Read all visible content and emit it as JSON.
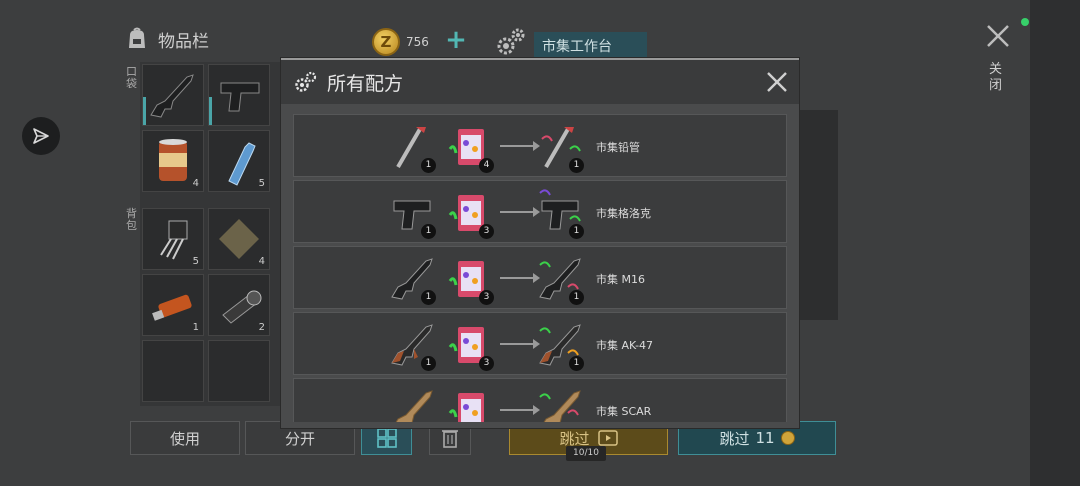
{
  "inventory": {
    "title": "物品栏",
    "pocket_label": "口袋",
    "backpack_label": "背包",
    "slots": [
      {
        "name": "rifle",
        "count": ""
      },
      {
        "name": "pistol",
        "count": ""
      },
      {
        "name": "canned-food",
        "count": "4"
      },
      {
        "name": "water-bottle",
        "count": "5"
      },
      {
        "name": "transistor",
        "count": "5"
      },
      {
        "name": "cloth",
        "count": "4"
      },
      {
        "name": "usb-drive",
        "count": "1"
      },
      {
        "name": "flashlight",
        "count": "2"
      }
    ]
  },
  "currency": {
    "coins": "756",
    "coin_glyph": "Z"
  },
  "workbench": {
    "label": "市集工作台"
  },
  "close": {
    "label": "关闭"
  },
  "modal": {
    "title": "所有配方",
    "recipes": [
      {
        "input_count": "1",
        "material_count": "4",
        "output_count": "1",
        "name": "市集铅管"
      },
      {
        "input_count": "1",
        "material_count": "3",
        "output_count": "1",
        "name": "市集格洛克"
      },
      {
        "input_count": "1",
        "material_count": "3",
        "output_count": "1",
        "name": "市集 M16"
      },
      {
        "input_count": "1",
        "material_count": "3",
        "output_count": "1",
        "name": "市集 AK-47"
      },
      {
        "input_count": "1",
        "material_count": "3",
        "output_count": "1",
        "name": "市集 SCAR"
      }
    ]
  },
  "buttons": {
    "use": "使用",
    "split": "分开",
    "skip_ad": "跳过",
    "skip_progress": "10/10",
    "skip_gold": "跳过",
    "skip_gold_cost": "11"
  },
  "colors": {
    "accent": "#4aa5a8",
    "gold": "#d0a43a",
    "modal_bg": "#4a4b4c"
  }
}
